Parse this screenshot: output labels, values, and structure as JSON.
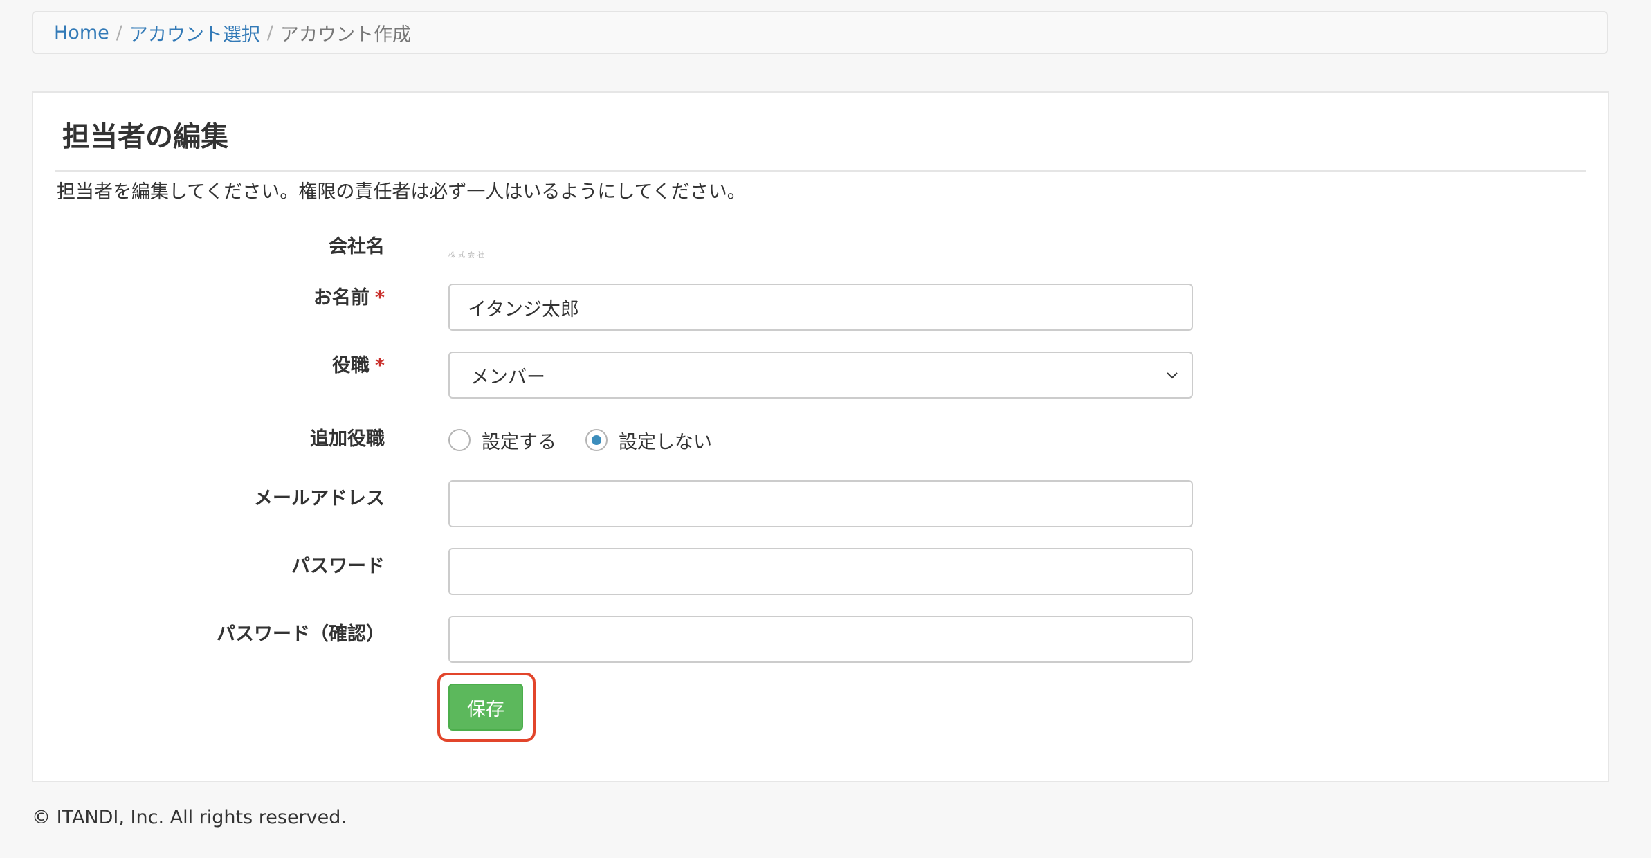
{
  "breadcrumb": {
    "items": [
      "Home",
      "アカウント選択"
    ],
    "separator": "/",
    "current": "アカウント作成"
  },
  "panel": {
    "title": "担当者の編集",
    "description": "担当者を編集してください。権限の責任者は必ず一人はいるようにしてください。"
  },
  "form": {
    "company": {
      "label": "会社名",
      "value": "株式会社"
    },
    "name": {
      "label": "お名前",
      "required_mark": "*",
      "value": "イタンジ太郎"
    },
    "position": {
      "label": "役職",
      "required_mark": "*",
      "selected": "メンバー",
      "icon": "chevron-down-icon"
    },
    "extra_position": {
      "label": "追加役職",
      "options": [
        {
          "label": "設定する",
          "checked": false
        },
        {
          "label": "設定しない",
          "checked": true
        }
      ],
      "accent_color": "#3c8dbc"
    },
    "email": {
      "label": "メールアドレス",
      "value": ""
    },
    "password": {
      "label": "パスワード",
      "value": ""
    },
    "password_confirm": {
      "label": "パスワード（確認）",
      "value": ""
    },
    "save_label": "保存",
    "save_color": "#5cb85c",
    "highlight_color": "#e2452b"
  },
  "footer": {
    "text": "© ITANDI, Inc. All rights reserved."
  }
}
